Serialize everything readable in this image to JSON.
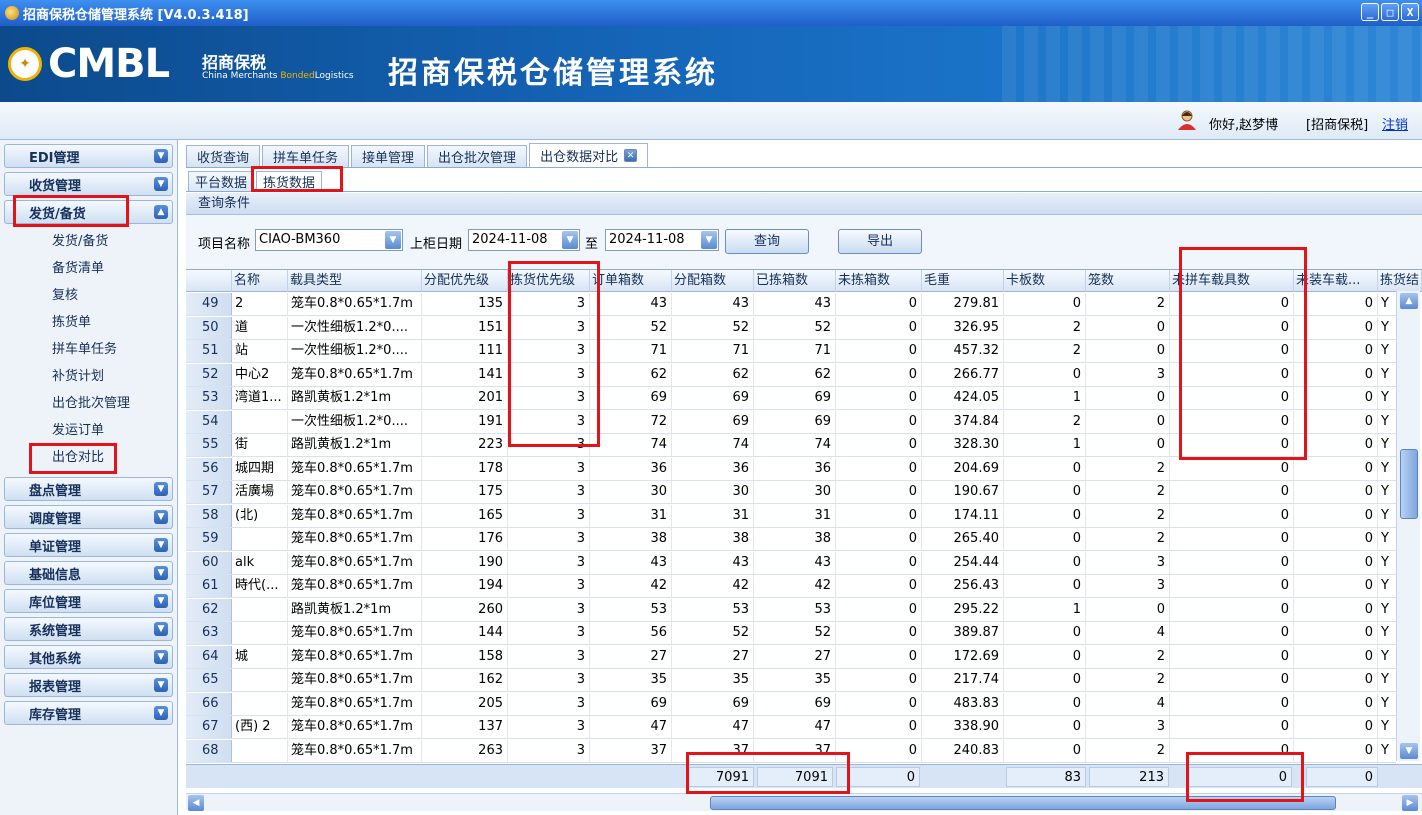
{
  "window": {
    "title": "招商保税仓储管理系统 [V4.0.3.418]",
    "buttons": [
      "_",
      "□",
      "X"
    ]
  },
  "banner": {
    "logo_text": "CMBL",
    "brand_cn": "招商保税",
    "brand_en_1": "China Merchants ",
    "brand_en_2": "Bonded",
    "brand_en_3": "Logistics",
    "system_title": "招商保税仓储管理系统"
  },
  "user": {
    "greeting": "你好,赵梦博",
    "company": "[招商保税]",
    "logout": "注销"
  },
  "sidebar": {
    "groups_top": [
      "EDI管理",
      "收货管理"
    ],
    "expanded_group": "发货/备货",
    "sub_items": [
      "发货/备货",
      "备货清单",
      "复核",
      "拣货单",
      "拼车单任务",
      "补货计划",
      "出仓批次管理",
      "发运订单",
      "出仓对比"
    ],
    "groups_bottom": [
      "盘点管理",
      "调度管理",
      "单证管理",
      "基础信息",
      "库位管理",
      "系统管理",
      "其他系统",
      "报表管理",
      "库存管理"
    ]
  },
  "tabs": [
    "收货查询",
    "拼车单任务",
    "接单管理",
    "出仓批次管理",
    "出仓数据对比"
  ],
  "subtabs": [
    "平台数据",
    "拣货数据"
  ],
  "query": {
    "section_title": "查询条件",
    "project_label": "项目名称",
    "project_value": "CIAO-BM360",
    "date_label": "上柜日期",
    "date_from": "2024-11-08",
    "to_label": "至",
    "date_to": "2024-11-08",
    "search_button": "查询",
    "export_button": "导出"
  },
  "table": {
    "columns": [
      "名称",
      "载具类型",
      "分配优先级",
      "拣货优先级",
      "订单箱数",
      "分配箱数",
      "已拣箱数",
      "未拣箱数",
      "毛重",
      "卡板数",
      "笼数",
      "未拼车载具数",
      "未装车载...",
      "拣货结"
    ],
    "rows": [
      [
        "49",
        "2",
        "笼车0.8*0.65*1.7m",
        "135",
        "3",
        "43",
        "43",
        "43",
        "0",
        "279.81",
        "0",
        "2",
        "0",
        "0",
        "Y"
      ],
      [
        "50",
        "道",
        "一次性细板1.2*0....",
        "151",
        "3",
        "52",
        "52",
        "52",
        "0",
        "326.95",
        "2",
        "0",
        "0",
        "0",
        "Y"
      ],
      [
        "51",
        "站",
        "一次性细板1.2*0....",
        "111",
        "3",
        "71",
        "71",
        "71",
        "0",
        "457.32",
        "2",
        "0",
        "0",
        "0",
        "Y"
      ],
      [
        "52",
        "中心2",
        "笼车0.8*0.65*1.7m",
        "141",
        "3",
        "62",
        "62",
        "62",
        "0",
        "266.77",
        "0",
        "3",
        "0",
        "0",
        "Y"
      ],
      [
        "53",
        "湾道1...",
        "路凯黄板1.2*1m",
        "201",
        "3",
        "69",
        "69",
        "69",
        "0",
        "424.05",
        "1",
        "0",
        "0",
        "0",
        "Y"
      ],
      [
        "54",
        "",
        "一次性细板1.2*0....",
        "191",
        "3",
        "72",
        "69",
        "69",
        "0",
        "374.84",
        "2",
        "0",
        "0",
        "0",
        "Y"
      ],
      [
        "55",
        "街",
        "路凯黄板1.2*1m",
        "223",
        "3",
        "74",
        "74",
        "74",
        "0",
        "328.30",
        "1",
        "0",
        "0",
        "0",
        "Y"
      ],
      [
        "56",
        "城四期",
        "笼车0.8*0.65*1.7m",
        "178",
        "3",
        "36",
        "36",
        "36",
        "0",
        "204.69",
        "0",
        "2",
        "0",
        "0",
        "Y"
      ],
      [
        "57",
        "活廣場",
        "笼车0.8*0.65*1.7m",
        "175",
        "3",
        "30",
        "30",
        "30",
        "0",
        "190.67",
        "0",
        "2",
        "0",
        "0",
        "Y"
      ],
      [
        "58",
        "(北)",
        "笼车0.8*0.65*1.7m",
        "165",
        "3",
        "31",
        "31",
        "31",
        "0",
        "174.11",
        "0",
        "2",
        "0",
        "0",
        "Y"
      ],
      [
        "59",
        "",
        "笼车0.8*0.65*1.7m",
        "176",
        "3",
        "38",
        "38",
        "38",
        "0",
        "265.40",
        "0",
        "2",
        "0",
        "0",
        "Y"
      ],
      [
        "60",
        "alk",
        "笼车0.8*0.65*1.7m",
        "190",
        "3",
        "43",
        "43",
        "43",
        "0",
        "254.44",
        "0",
        "3",
        "0",
        "0",
        "Y"
      ],
      [
        "61",
        "時代(...",
        "笼车0.8*0.65*1.7m",
        "194",
        "3",
        "42",
        "42",
        "42",
        "0",
        "256.43",
        "0",
        "3",
        "0",
        "0",
        "Y"
      ],
      [
        "62",
        "",
        "路凯黄板1.2*1m",
        "260",
        "3",
        "53",
        "53",
        "53",
        "0",
        "295.22",
        "1",
        "0",
        "0",
        "0",
        "Y"
      ],
      [
        "63",
        "",
        "笼车0.8*0.65*1.7m",
        "144",
        "3",
        "56",
        "52",
        "52",
        "0",
        "389.87",
        "0",
        "4",
        "0",
        "0",
        "Y"
      ],
      [
        "64",
        "城",
        "笼车0.8*0.65*1.7m",
        "158",
        "3",
        "27",
        "27",
        "27",
        "0",
        "172.69",
        "0",
        "2",
        "0",
        "0",
        "Y"
      ],
      [
        "65",
        "",
        "笼车0.8*0.65*1.7m",
        "162",
        "3",
        "35",
        "35",
        "35",
        "0",
        "217.74",
        "0",
        "2",
        "0",
        "0",
        "Y"
      ],
      [
        "66",
        "",
        "笼车0.8*0.65*1.7m",
        "205",
        "3",
        "69",
        "69",
        "69",
        "0",
        "483.83",
        "0",
        "4",
        "0",
        "0",
        "Y"
      ],
      [
        "67",
        "(西) 2",
        "笼车0.8*0.65*1.7m",
        "137",
        "3",
        "47",
        "47",
        "47",
        "0",
        "338.90",
        "0",
        "3",
        "0",
        "0",
        "Y"
      ],
      [
        "68",
        "",
        "笼车0.8*0.65*1.7m",
        "263",
        "3",
        "37",
        "37",
        "37",
        "0",
        "240.83",
        "0",
        "2",
        "0",
        "0",
        "Y"
      ]
    ],
    "totals": {
      "alloc_boxes": "7091",
      "picked_boxes": "7091",
      "unpicked_boxes": "0",
      "pallets": "83",
      "cages": "213",
      "unpooled": "0",
      "unloaded": "0"
    }
  }
}
